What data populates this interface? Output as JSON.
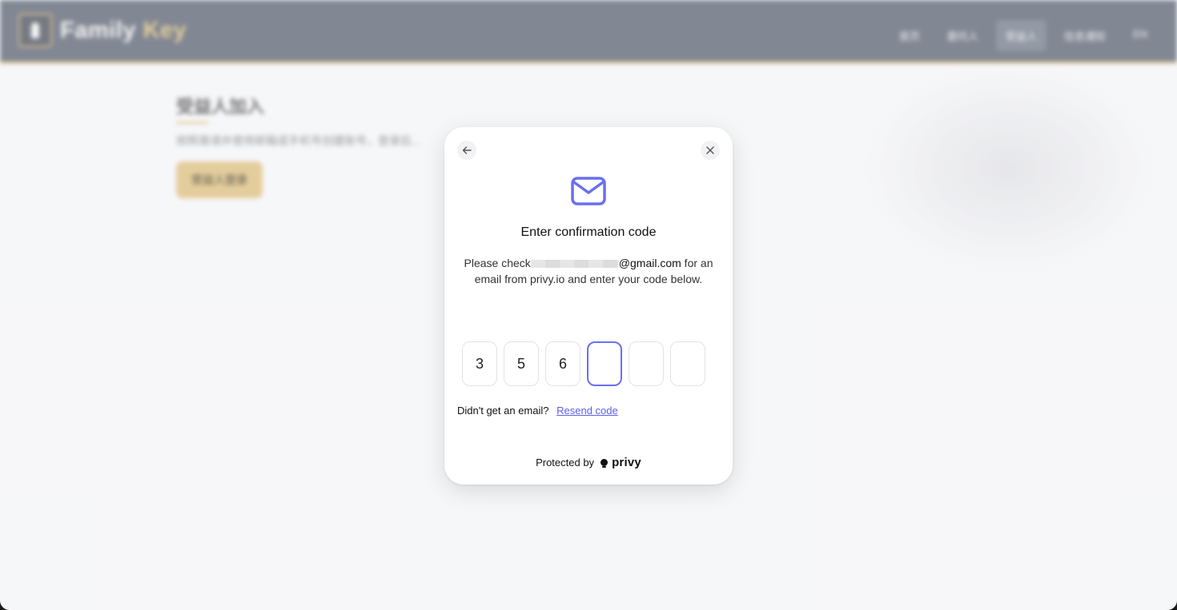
{
  "app": {
    "brand_primary": "Family",
    "brand_accent": "Key",
    "nav": [
      "首页",
      "委托人",
      "受益人",
      "信息通知",
      "EN"
    ],
    "active_nav_index": 2,
    "page_title": "受益人加入",
    "page_desc": "按照邀请并使用邮箱或手机号创建账号，登录后...",
    "join_button": "受益人登录"
  },
  "modal": {
    "title": "Enter confirmation code",
    "desc_prefix": "Please check",
    "email_domain": "@gmail.com",
    "desc_suffix": " for an email from privy.io and enter your code below.",
    "code_digits": [
      "3",
      "5",
      "6",
      "",
      "",
      ""
    ],
    "focused_index": 3,
    "no_email_text": "Didn't get an email?",
    "resend_label": "Resend code",
    "protected_text": "Protected by",
    "privy_brand": "privy"
  },
  "icons": {
    "back": "arrow-left-icon",
    "close": "close-icon",
    "mail": "mail-icon",
    "logo": "keyhole-icon"
  },
  "colors": {
    "accent": "#6a6ff0",
    "gold": "#d9b66a",
    "header": "#424b5c"
  }
}
